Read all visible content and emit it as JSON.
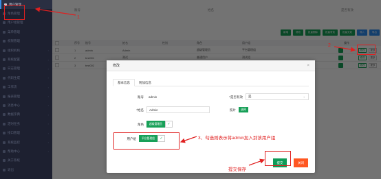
{
  "sidebar": {
    "items": [
      {
        "label": "用户管理",
        "active": true
      },
      {
        "label": "角色管理"
      },
      {
        "label": "用户组管理"
      },
      {
        "label": "菜单管理"
      },
      {
        "label": "权限管理"
      },
      {
        "label": "组织机构"
      },
      {
        "label": "系统配置"
      },
      {
        "label": "日志管理"
      },
      {
        "label": "代码生成"
      },
      {
        "label": "工作流"
      },
      {
        "label": "报表管理"
      },
      {
        "label": "消息中心"
      },
      {
        "label": "数据字典"
      },
      {
        "label": "定时任务"
      },
      {
        "label": "接口管理"
      },
      {
        "label": "系统监控"
      },
      {
        "label": "帮助中心"
      },
      {
        "label": "关于系统"
      },
      {
        "label": "退出"
      }
    ]
  },
  "topbar": {
    "left": "账号",
    "mid": "姓名",
    "right": "是否有效"
  },
  "toolbar": {
    "buttons": [
      "新增",
      "修改",
      "批量删除",
      "批量有效",
      "批量无效",
      "导入",
      "导出"
    ]
  },
  "table": {
    "headers": [
      "序号",
      "账号",
      "姓名",
      "性别",
      "角色",
      "用户组",
      "操作"
    ],
    "rows": [
      {
        "no": "1",
        "account": "admin",
        "name": "Admin",
        "role": "超级管理员",
        "group": "平台管理组"
      },
      {
        "no": "2",
        "account": "test001",
        "name": "测试",
        "role": "普通用户",
        "group": "测试组"
      },
      {
        "no": "3",
        "account": "test002",
        "name": "测试2",
        "role": "普通用户",
        "group": "测试组"
      }
    ],
    "edit_label": "修改",
    "more_label": "更多"
  },
  "modal": {
    "title": "修改",
    "close_icon": "×",
    "tabs": [
      "基本信息",
      "附加信息"
    ],
    "fields": {
      "account_label": "账号",
      "account_value": "admin",
      "valid_label": "*是否有效",
      "valid_value": "是",
      "name_label": "*姓名",
      "name_value": "Admin",
      "photo_label": "照片",
      "photo_button": "选择",
      "role_label": "角色",
      "role_value": "超级管理员",
      "group_label": "用户组",
      "group_value": "平台管理组"
    },
    "submit_label": "提交",
    "close_label": "关闭"
  },
  "annotations": {
    "step1": "1",
    "step2": "2",
    "step3": "3、勾选则表示将admin加入到该用户组",
    "submit_note": "提交保存"
  },
  "colors": {
    "accent": "#18a058",
    "annotation": "#e02020",
    "close": "#ff5722"
  }
}
